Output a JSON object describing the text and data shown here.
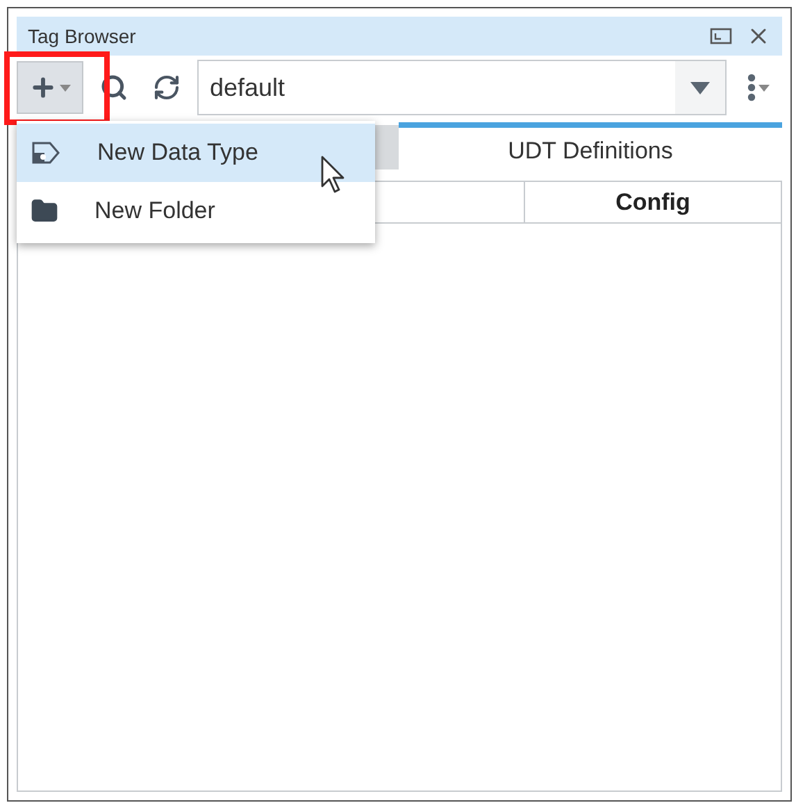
{
  "window": {
    "title": "Tag Browser"
  },
  "toolbar": {
    "add_button_highlighted": true,
    "provider": {
      "value": "default"
    }
  },
  "tabs": [
    {
      "label": "UDT Definitions",
      "selected": true
    }
  ],
  "table": {
    "columns": [
      "Config"
    ]
  },
  "menu": {
    "items": [
      {
        "label": "New Data Type",
        "kind": "data-type",
        "hovered": true
      },
      {
        "label": "New Folder",
        "kind": "folder",
        "hovered": false
      }
    ]
  }
}
